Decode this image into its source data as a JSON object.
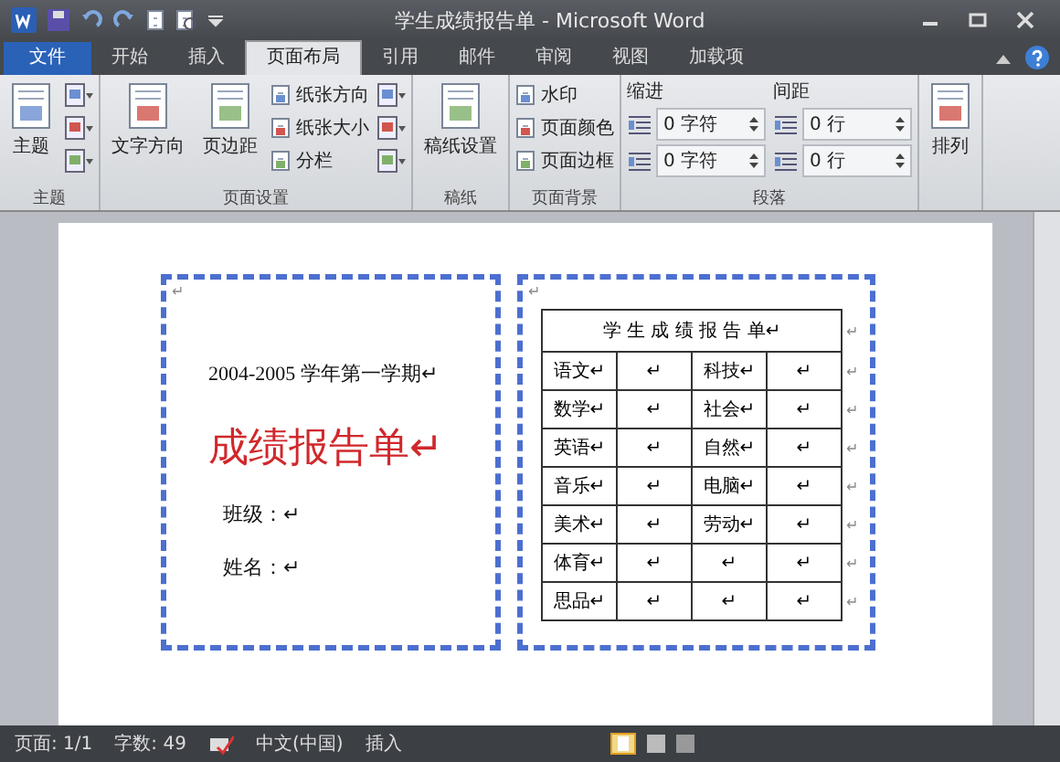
{
  "window": {
    "title": "学生成绩报告单 - Microsoft Word"
  },
  "tabs": [
    {
      "label": "文件",
      "kind": "file",
      "selected": false
    },
    {
      "label": "开始",
      "kind": "tab",
      "selected": false
    },
    {
      "label": "插入",
      "kind": "tab",
      "selected": false
    },
    {
      "label": "页面布局",
      "kind": "tab",
      "selected": true
    },
    {
      "label": "引用",
      "kind": "tab",
      "selected": false
    },
    {
      "label": "邮件",
      "kind": "tab",
      "selected": false
    },
    {
      "label": "审阅",
      "kind": "tab",
      "selected": false
    },
    {
      "label": "视图",
      "kind": "tab",
      "selected": false
    },
    {
      "label": "加载项",
      "kind": "tab",
      "selected": false
    }
  ],
  "ribbon": {
    "groups": [
      {
        "label": "主题",
        "items": [
          {
            "kind": "large",
            "label": "主题"
          },
          {
            "kind": "icons"
          }
        ]
      },
      {
        "label": "页面设置",
        "items": [
          {
            "kind": "large",
            "label": "文字方向"
          },
          {
            "kind": "large",
            "label": "页边距"
          },
          {
            "kind": "small",
            "labels": [
              "纸张方向",
              "纸张大小",
              "分栏"
            ]
          },
          {
            "kind": "icons"
          }
        ]
      },
      {
        "label": "稿纸",
        "items": [
          {
            "kind": "large",
            "label": "稿纸设置"
          }
        ]
      },
      {
        "label": "页面背景",
        "items": [
          {
            "kind": "small",
            "labels": [
              "水印",
              "页面颜色",
              "页面边框"
            ]
          }
        ]
      },
      {
        "label": "段落",
        "items": [
          {
            "kind": "spinners",
            "heading": "缩进",
            "values": [
              "0 字符",
              "0 字符"
            ]
          },
          {
            "kind": "spinners",
            "heading": "间距",
            "values": [
              "0 行",
              "0 行"
            ]
          }
        ]
      },
      {
        "items": [
          {
            "kind": "large",
            "label": "排列"
          }
        ]
      }
    ]
  },
  "document": {
    "left_panel": {
      "top_mark": "↵",
      "term": "2004-2005 学年第一学期↵",
      "title": "成绩报告单↵",
      "fields": [
        "班级：↵",
        "姓名：↵"
      ]
    },
    "right_panel": {
      "top_mark": "↵",
      "caption": "学 生 成 绩 报 告 单↵",
      "caption_end": "↵",
      "rows": [
        {
          "cells": [
            "语文↵",
            "↵",
            "科技↵",
            "↵"
          ],
          "end": "↵"
        },
        {
          "cells": [
            "数学↵",
            "↵",
            "社会↵",
            "↵"
          ],
          "end": "↵"
        },
        {
          "cells": [
            "英语↵",
            "↵",
            "自然↵",
            "↵"
          ],
          "end": "↵"
        },
        {
          "cells": [
            "音乐↵",
            "↵",
            "电脑↵",
            "↵"
          ],
          "end": "↵"
        },
        {
          "cells": [
            "美术↵",
            "↵",
            "劳动↵",
            "↵"
          ],
          "end": "↵"
        },
        {
          "cells": [
            "体育↵",
            "↵",
            "↵",
            "↵"
          ],
          "end": "↵"
        },
        {
          "cells": [
            "思品↵",
            "↵",
            "↵",
            "↵"
          ],
          "end": "↵"
        }
      ]
    }
  },
  "status_bar": [
    "页面: 1/1",
    "字数: 49",
    "中文(中国)",
    "插入"
  ]
}
